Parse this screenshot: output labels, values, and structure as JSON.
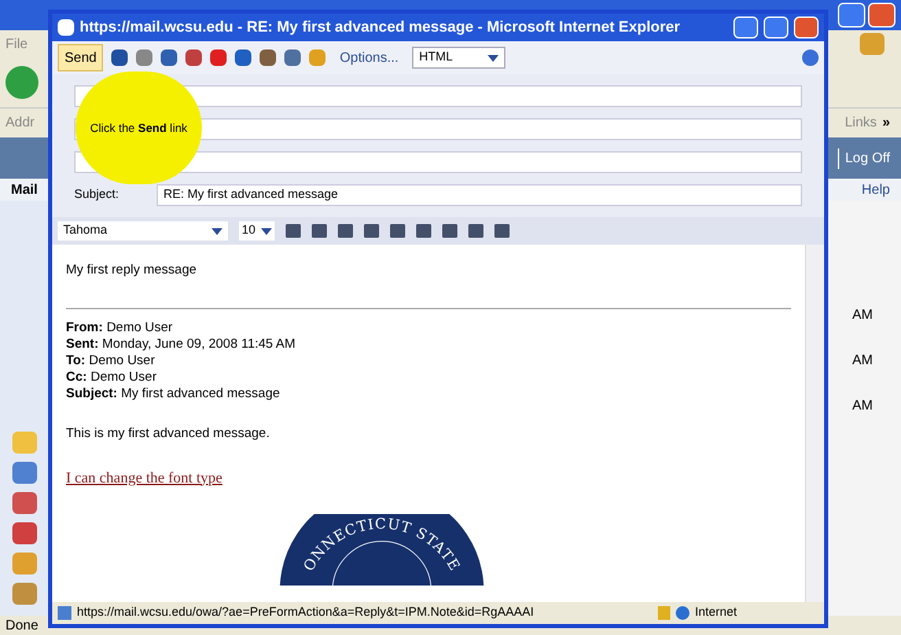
{
  "background_window": {
    "menu_fragment": "File",
    "address_fragment": "Addr",
    "links": "Links",
    "links_chevron": "»",
    "logoff": "Log Off",
    "nav_fragment": "Mail",
    "help": "Help",
    "times": [
      "AM",
      "AM",
      "AM"
    ],
    "status": "Done"
  },
  "window": {
    "title": "https://mail.wcsu.edu - RE: My first advanced message - Microsoft Internet Explorer"
  },
  "toolbar": {
    "send": "Send",
    "options": "Options...",
    "format": "HTML"
  },
  "callout": "Click the **Send** link",
  "subject": {
    "label": "Subject:",
    "value": "RE: My first advanced message"
  },
  "format_bar": {
    "font": "Tahoma",
    "size": "10"
  },
  "body": {
    "reply": "My first reply message",
    "header": [
      {
        "label": "From:",
        "value": "Demo User"
      },
      {
        "label": "Sent:",
        "value": "Monday, June 09, 2008 11:45 AM"
      },
      {
        "label": "To:",
        "value": "Demo User"
      },
      {
        "label": "Cc:",
        "value": "Demo User"
      },
      {
        "label": "Subject:",
        "value": "My first advanced message"
      }
    ],
    "original": "This is my first advanced message.",
    "link_text": "I can change the font type",
    "seal_text": "ONNECTICUT STATE"
  },
  "status_bar": {
    "url": "https://mail.wcsu.edu/owa/?ae=PreFormAction&a=Reply&t=IPM.Note&id=RgAAAAI",
    "zone": "Internet"
  }
}
